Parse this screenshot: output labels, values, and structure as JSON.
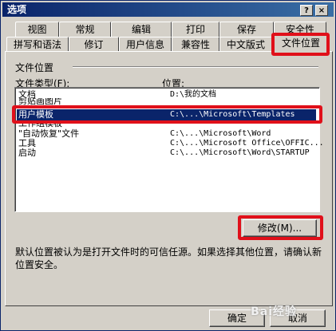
{
  "window": {
    "title": "选项",
    "help_btn": "?",
    "close_btn": "×"
  },
  "tabs_row1": [
    "视图",
    "常规",
    "编辑",
    "打印",
    "保存",
    "安全性"
  ],
  "tabs_row2": [
    "拼写和语法",
    "修订",
    "用户信息",
    "兼容性",
    "中文版式",
    "文件位置"
  ],
  "group": {
    "title": "文件位置",
    "col_type": "文件类型(F):",
    "col_location": "位置:"
  },
  "rows": [
    {
      "type": "文档",
      "location": "D:\\我的文档"
    },
    {
      "type": "剪贴画图片",
      "location": ""
    },
    {
      "type": "用户模板",
      "location": "C:\\...\\Microsoft\\Templates"
    },
    {
      "type": "工作组模板",
      "location": ""
    },
    {
      "type": "\"自动恢复\"文件",
      "location": "C:\\...\\Microsoft\\Word"
    },
    {
      "type": "工具",
      "location": "C:\\...\\Microsoft Office\\OFFIC..."
    },
    {
      "type": "启动",
      "location": "C:\\...\\Microsoft\\Word\\STARTUP"
    }
  ],
  "modify_button": "修改(M)...",
  "hint": "默认位置被认为是打开文件时的可信任源。如果选择其他位置，请确认新位置安全。",
  "ok_button": "确定",
  "cancel_button": "取消",
  "watermark": "Bai经验"
}
